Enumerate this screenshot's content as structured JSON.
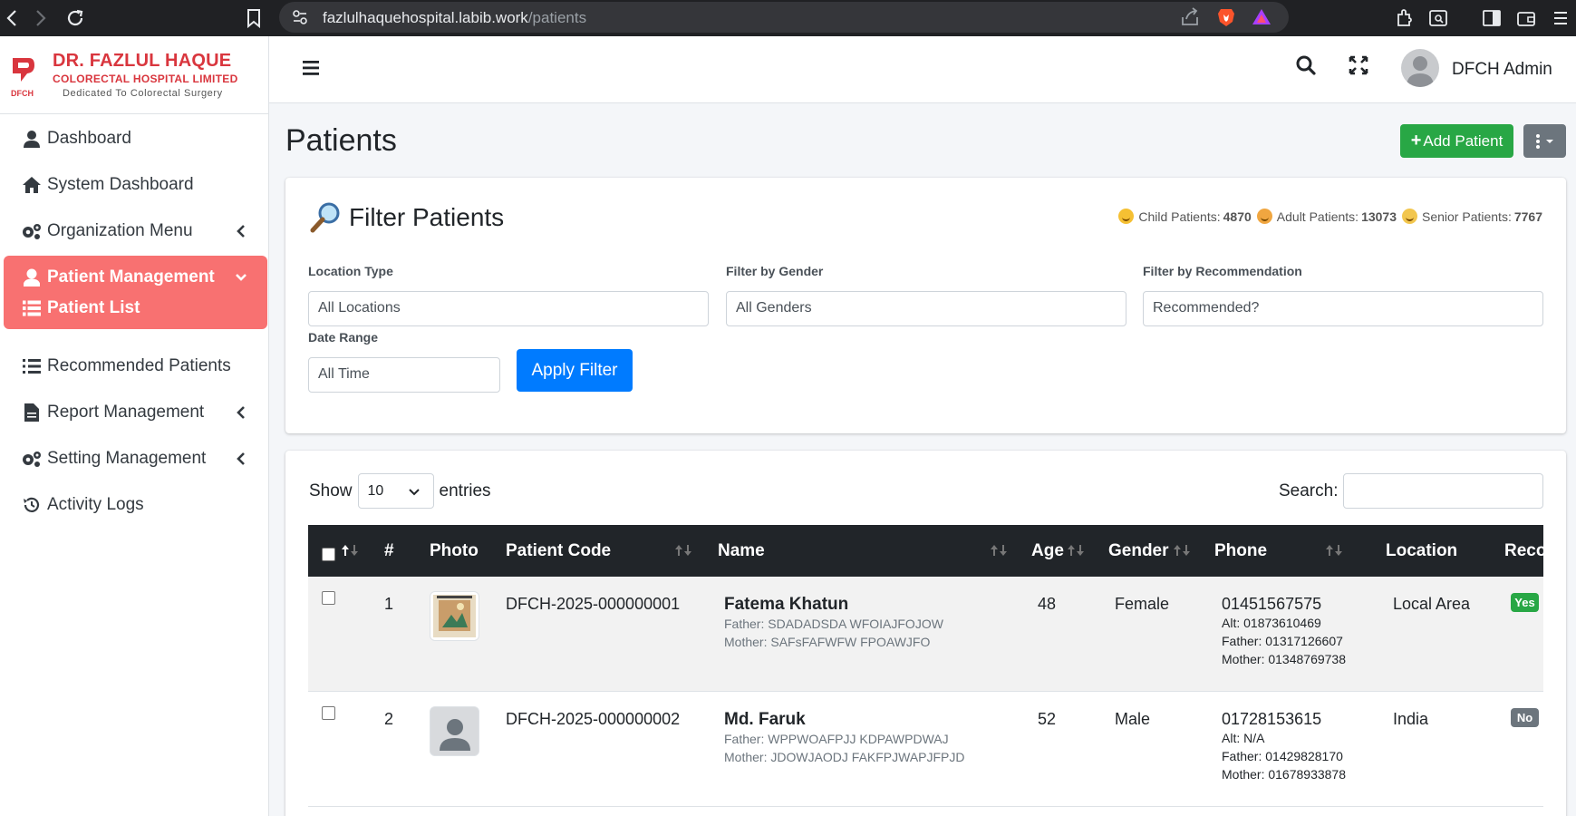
{
  "browser": {
    "url_host": "fazlulhaquehospital.labib.work",
    "url_path": "/patients"
  },
  "brand": {
    "line1": "DR. FAZLUL HAQUE",
    "line2": "COLORECTAL HOSPITAL LIMITED",
    "line3": "Dedicated To Colorectal Surgery",
    "abbr": "DFCH"
  },
  "sidebar": {
    "items": [
      {
        "label": "Dashboard"
      },
      {
        "label": "System Dashboard"
      },
      {
        "label": "Organization Menu"
      },
      {
        "label": "Patient Management"
      },
      {
        "label": "Patient List"
      },
      {
        "label": "Recommended Patients"
      },
      {
        "label": "Report Management"
      },
      {
        "label": "Setting Management"
      },
      {
        "label": "Activity Logs"
      }
    ]
  },
  "topbar": {
    "user_name": "DFCH Admin"
  },
  "page": {
    "title": "Patients",
    "add_label": "Add Patient"
  },
  "filter": {
    "title": "Filter Patients",
    "stats": {
      "child_label": "Child Patients:",
      "child_count": "4870",
      "adult_label": "Adult Patients:",
      "adult_count": "13073",
      "senior_label": "Senior Patients:",
      "senior_count": "7767"
    },
    "location_label": "Location Type",
    "location_value": "All Locations",
    "gender_label": "Filter by Gender",
    "gender_value": "All Genders",
    "recommendation_label": "Filter by Recommendation",
    "recommendation_value": "Recommended?",
    "date_label": "Date Range",
    "date_value": "All Time",
    "apply_label": "Apply Filter"
  },
  "table": {
    "show_label": "Show",
    "entries_value": "10",
    "entries_label": "entries",
    "search_label": "Search:",
    "columns": [
      "#",
      "Photo",
      "Patient Code",
      "Name",
      "Age",
      "Gender",
      "Phone",
      "Location",
      "Reco"
    ],
    "rows": [
      {
        "index": "1",
        "code": "DFCH-2025-000000001",
        "name": "Fatema Khatun",
        "father": "Father: SDADADSDA WFOIAJFOJOW",
        "mother": "Mother: SAFsFAFWFW FPOAWJFO",
        "age": "48",
        "gender": "Female",
        "phone": "01451567575",
        "alt": "Alt: 01873610469",
        "father_phone": "Father: 01317126607",
        "mother_phone": "Mother: 01348769738",
        "location": "Local Area",
        "recommended": "Yes"
      },
      {
        "index": "2",
        "code": "DFCH-2025-000000002",
        "name": "Md. Faruk",
        "father": "Father: WPPWOAFPJJ KDPAWPDWAJ",
        "mother": "Mother: JDOWJAODJ FAKFPJWAPJFPJD",
        "age": "52",
        "gender": "Male",
        "phone": "01728153615",
        "alt": "Alt: N/A",
        "father_phone": "Father: 01429828170",
        "mother_phone": "Mother: 01678933878",
        "location": "India",
        "recommended": "No"
      }
    ]
  },
  "colors": {
    "active_menu": "#f87171",
    "brand_red": "#d9363e",
    "success": "#28a745",
    "primary": "#007bff",
    "table_header": "#212529"
  }
}
